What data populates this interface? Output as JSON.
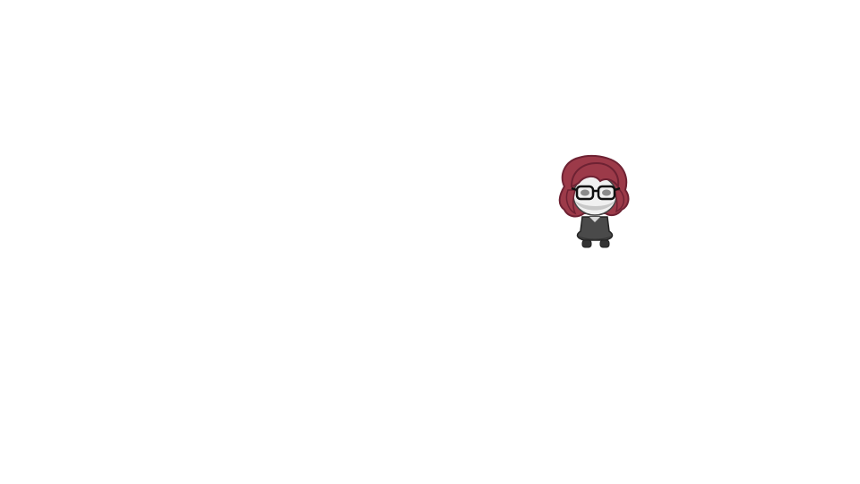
{
  "scene": {
    "background_color": "#ffffff",
    "character": {
      "icon": "red-haired-girl-with-glasses-sprite",
      "colors": {
        "hair": "#9c3a49",
        "hair_outline": "#6e2233",
        "skin": "#f0f0f0",
        "face_shadow": "#c8c8c8",
        "glasses": "#111111",
        "eyes": "#8a8a8a",
        "dress": "#4a4a4a",
        "dress_dark": "#333333",
        "outline": "#222222"
      }
    }
  }
}
